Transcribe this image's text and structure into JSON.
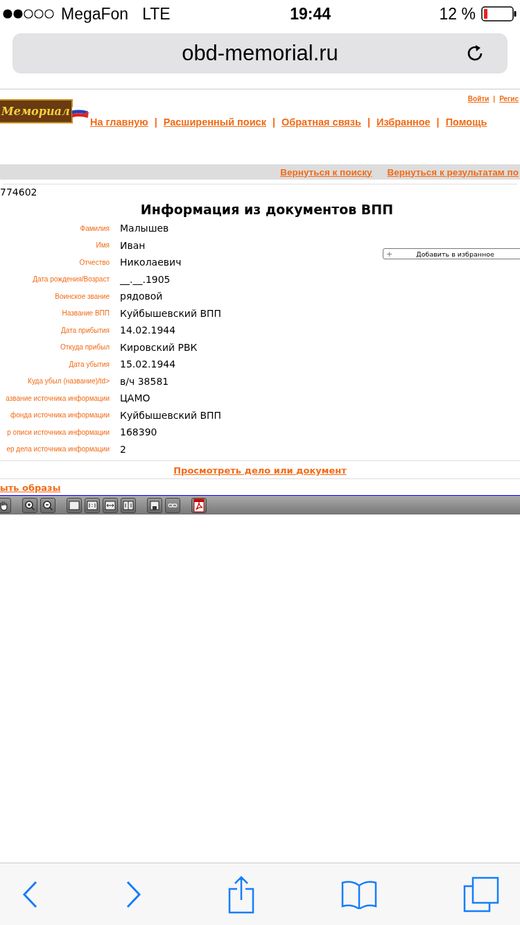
{
  "status_bar": {
    "carrier": "MegaFon",
    "network": "LTE",
    "time": "19:44",
    "battery": "12 %"
  },
  "address_bar": {
    "url": "obd-memorial.ru"
  },
  "header": {
    "logo_text": "Мемориал",
    "account_links": [
      "Войти",
      "Регис"
    ],
    "account_separators": [
      "|"
    ],
    "nav": [
      "На главную",
      "Расширенный поиск",
      "Обратная связь",
      "Избранное",
      "Помощь"
    ],
    "nav_separators": [
      "|",
      "|",
      "|",
      "|"
    ]
  },
  "back_links": [
    "Вернуться к поиску",
    "Вернуться к результатам по"
  ],
  "record_id": "774602",
  "title": "Информация из документов ВПП",
  "favorite_button": {
    "label": "Добавить в избранное",
    "icon": "+"
  },
  "fields": [
    {
      "label": "Фамилия",
      "value": "Малышев"
    },
    {
      "label": "Имя",
      "value": "Иван"
    },
    {
      "label": "Отчество",
      "value": "Николаевич"
    },
    {
      "label": "Дата рождения/Возраст",
      "value": "__.__.1905"
    },
    {
      "label": "Воинское звание",
      "value": "рядовой"
    },
    {
      "label": "Название ВПП",
      "value": "Куйбышевский ВПП"
    },
    {
      "label": "Дата прибытия",
      "value": "14.02.1944"
    },
    {
      "label": "Откуда прибыл",
      "value": "Кировский РВК"
    },
    {
      "label": "Дата убытия",
      "value": "15.02.1944"
    },
    {
      "label": "Куда убыл (название)/td>",
      "value": "в/ч 38581"
    },
    {
      "label": "азвание источника информации",
      "value": "ЦАМО"
    },
    {
      "label": "фонда источника информации",
      "value": "Куйбышевский ВПП"
    },
    {
      "label": "р описи источника информации",
      "value": "168390"
    },
    {
      "label": "ер дела источника информации",
      "value": "2"
    }
  ],
  "view_document_link": "Просмотреть дело или документ",
  "images_link": "ыть образы"
}
